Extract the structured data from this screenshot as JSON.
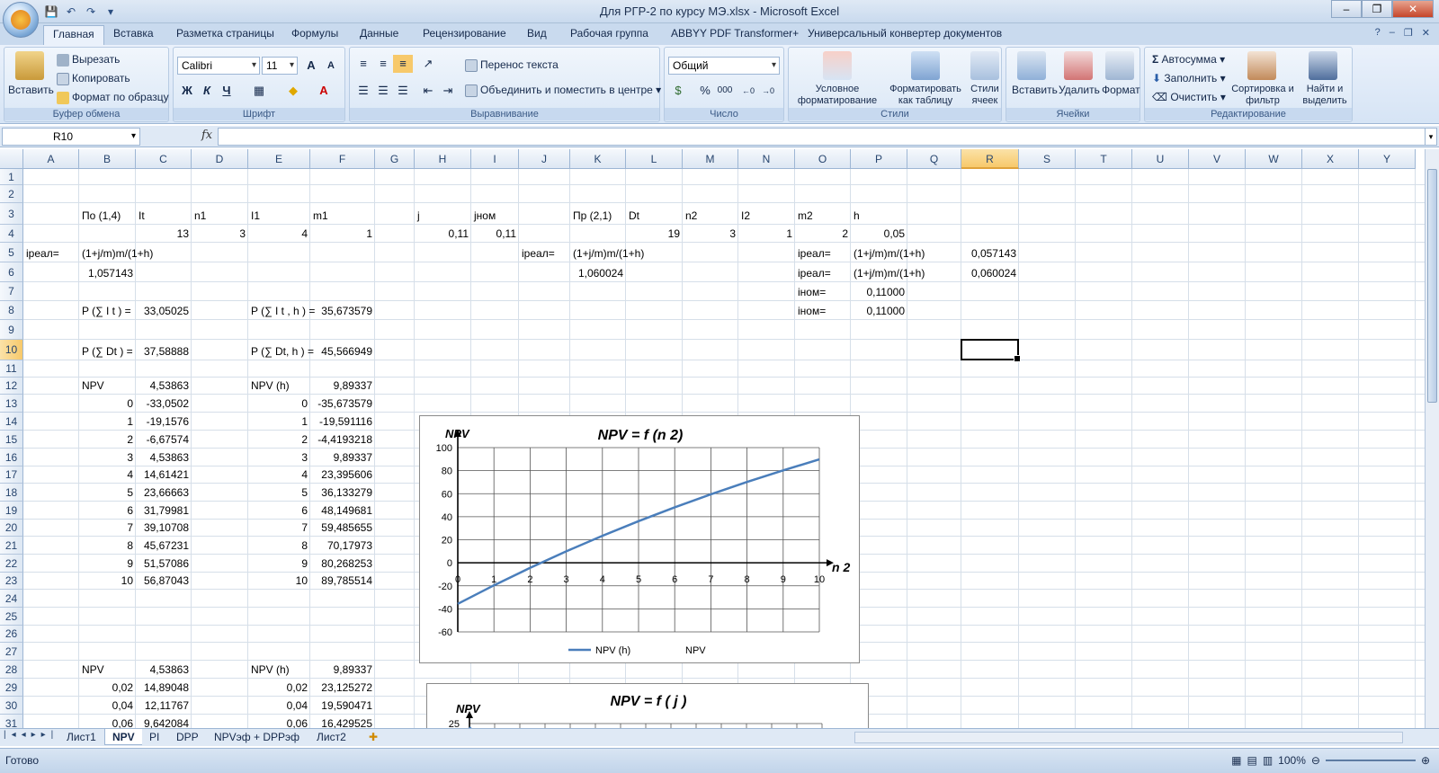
{
  "window": {
    "title": "Для РГР-2 по курсу МЭ.xlsx - Microsoft Excel"
  },
  "tabs": [
    "Главная",
    "Вставка",
    "Разметка страницы",
    "Формулы",
    "Данные",
    "Рецензирование",
    "Вид",
    "Рабочая группа",
    "ABBYY PDF Transformer+",
    "Универсальный конвертер документов"
  ],
  "ribbon": {
    "clipboard": {
      "name": "Буфер обмена",
      "paste": "Вставить",
      "cut": "Вырезать",
      "copy": "Копировать",
      "format_painter": "Формат по образцу"
    },
    "font": {
      "name": "Шрифт",
      "family": "Calibri",
      "size": "11",
      "bold": "Ж",
      "italic": "К",
      "underline": "Ч"
    },
    "alignment": {
      "name": "Выравнивание",
      "wrap": "Перенос текста",
      "merge": "Объединить и поместить в центре"
    },
    "number": {
      "name": "Число",
      "format": "Общий",
      "percent": "%",
      "thousands": "000"
    },
    "styles": {
      "name": "Стили",
      "conditional": "Условное форматирование",
      "as_table": "Форматировать как таблицу",
      "cell_styles": "Стили ячеек"
    },
    "cells": {
      "name": "Ячейки",
      "insert": "Вставить",
      "delete": "Удалить",
      "format": "Формат"
    },
    "editing": {
      "name": "Редактирование",
      "autosum": "Автосумма",
      "fill": "Заполнить",
      "clear": "Очистить",
      "sort": "Сортировка и фильтр",
      "find": "Найти и выделить"
    }
  },
  "namebox": "R10",
  "fx": "fx",
  "columns": [
    "A",
    "B",
    "C",
    "D",
    "E",
    "F",
    "G",
    "H",
    "I",
    "J",
    "K",
    "L",
    "M",
    "N",
    "O",
    "P",
    "Q",
    "R",
    "S",
    "T",
    "U",
    "V",
    "W",
    "X",
    "Y"
  ],
  "rows": [
    "1",
    "2",
    "3",
    "4",
    "5",
    "6",
    "7",
    "8",
    "9",
    "10",
    "11",
    "12",
    "13",
    "14",
    "15",
    "16",
    "17",
    "18",
    "19",
    "20",
    "21",
    "22",
    "23",
    "24",
    "25",
    "26",
    "27",
    "28",
    "29",
    "30",
    "31"
  ],
  "cells": {
    "b3": "По (1,4)",
    "c3": "It",
    "d3": "n1",
    "e3": "I1",
    "f3": "m1",
    "h3": "j",
    "i3": "jном",
    "k3": "Пр (2,1)",
    "l3": "Dt",
    "m3": "n2",
    "n3": "I2",
    "o3": "m2",
    "p3": "h",
    "c4": "13",
    "d4": "3",
    "e4": "4",
    "f4": "1",
    "h4": "0,11",
    "i4": "0,11",
    "l4": "19",
    "m4": "3",
    "n4": "1",
    "o4": "2",
    "p4": "0,05",
    "a5": "iреал=",
    "b5": "(1+j/m)m/(1+h)",
    "j5": "iреал=",
    "k5": "(1+j/m)m/(1+h)",
    "o5": "iреал=",
    "p5": "(1+j/m)m/(1+h)",
    "r5": "0,057143",
    "b6": "1,057143",
    "k6": "1,060024",
    "o6": "iреал=",
    "p6": "(1+j/m)m/(1+h)",
    "r6": "0,060024",
    "o7": "iном=",
    "p7": "0,11000",
    "b8": "P (∑ I t ) =",
    "c8": "33,05025",
    "e8": "P (∑ I t , h ) =",
    "f8": "35,673579",
    "o8": "iном=",
    "p8": "0,11000",
    "b10": "P (∑ Dt ) =",
    "c10": "37,58888",
    "e10": "P (∑ Dt, h ) =",
    "f10": "45,566949",
    "b12": "NPV",
    "c12": "4,53863",
    "e12": "NPV (h)",
    "f12": "9,89337",
    "b28": "NPV",
    "c28": "4,53863",
    "e28": "NPV (h)",
    "f28": "9,89337"
  },
  "table1": [
    {
      "n": "0",
      "npv": "-33,0502",
      "n2": "0",
      "npvh": "-35,673579"
    },
    {
      "n": "1",
      "npv": "-19,1576",
      "n2": "1",
      "npvh": "-19,591116"
    },
    {
      "n": "2",
      "npv": "-6,67574",
      "n2": "2",
      "npvh": "-4,4193218"
    },
    {
      "n": "3",
      "npv": "4,53863",
      "n2": "3",
      "npvh": "9,89337"
    },
    {
      "n": "4",
      "npv": "14,61421",
      "n2": "4",
      "npvh": "23,395606"
    },
    {
      "n": "5",
      "npv": "23,66663",
      "n2": "5",
      "npvh": "36,133279"
    },
    {
      "n": "6",
      "npv": "31,79981",
      "n2": "6",
      "npvh": "48,149681"
    },
    {
      "n": "7",
      "npv": "39,10708",
      "n2": "7",
      "npvh": "59,485655"
    },
    {
      "n": "8",
      "npv": "45,67231",
      "n2": "8",
      "npvh": "70,17973"
    },
    {
      "n": "9",
      "npv": "51,57086",
      "n2": "9",
      "npvh": "80,268253"
    },
    {
      "n": "10",
      "npv": "56,87043",
      "n2": "10",
      "npvh": "89,785514"
    }
  ],
  "table2": [
    {
      "j": "0,02",
      "npv": "14,89048",
      "j2": "0,02",
      "npvh": "23,125272"
    },
    {
      "j": "0,04",
      "npv": "12,11767",
      "j2": "0,04",
      "npvh": "19,590471"
    },
    {
      "j": "0,06",
      "npv": "9,642084",
      "j2": "0,06",
      "npvh": "16,429525"
    }
  ],
  "chart_data": [
    {
      "type": "line",
      "title": "NPV = f (n 2)",
      "ylabel": "NPV",
      "xlabel": "n 2",
      "x": [
        0,
        1,
        2,
        3,
        4,
        5,
        6,
        7,
        8,
        9,
        10
      ],
      "ylim": [
        -60,
        100
      ],
      "xlim": [
        0,
        10
      ],
      "yticks": [
        100,
        80,
        60,
        40,
        20,
        0,
        -20,
        -40,
        -60
      ],
      "series": [
        {
          "name": "NPV (h)",
          "values": [
            -35.673579,
            -19.591116,
            -4.4193218,
            9.89337,
            23.395606,
            36.133279,
            48.149681,
            59.485655,
            70.17973,
            80.268253,
            89.785514
          ],
          "color": "#4a7ebb"
        },
        {
          "name": "NPV",
          "values": [],
          "color": "#c0504d"
        }
      ],
      "legend": "bottom",
      "grid": true
    },
    {
      "type": "line",
      "title": "NPV = f ( j )",
      "ylabel": "NPV",
      "yticks": [
        25
      ]
    }
  ],
  "sheet_tabs": [
    "Лист1",
    "NPV",
    "PI",
    "DPP",
    "NPVэф + DPPэф",
    "Лист2"
  ],
  "status": {
    "ready": "Готово",
    "zoom": "100%"
  }
}
